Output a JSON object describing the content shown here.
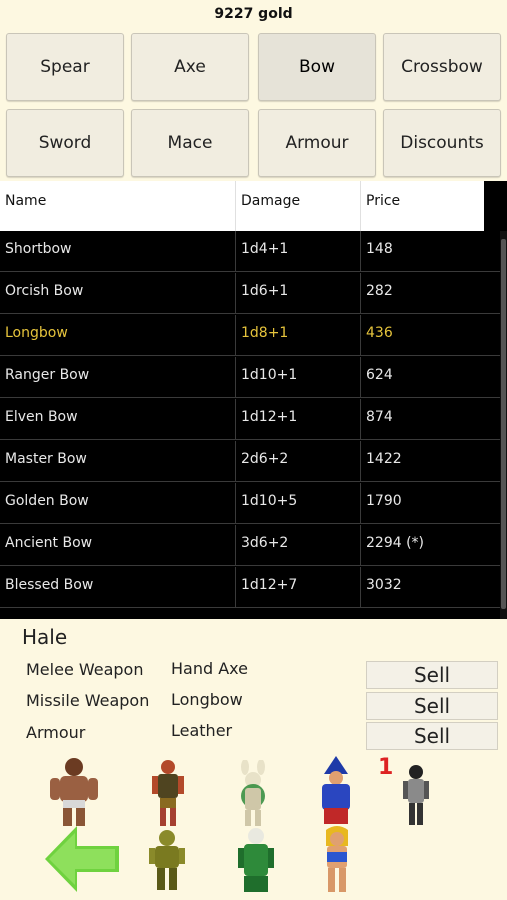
{
  "header": {
    "gold": "9227 gold"
  },
  "tabs": [
    {
      "label": "Spear"
    },
    {
      "label": "Axe"
    },
    {
      "label": "Bow"
    },
    {
      "label": "Crossbow"
    },
    {
      "label": "Sword"
    },
    {
      "label": "Mace"
    },
    {
      "label": "Armour"
    },
    {
      "label": "Discounts"
    }
  ],
  "table": {
    "columns": [
      "Name",
      "Damage",
      "Price"
    ],
    "rows": [
      {
        "name": "Shortbow",
        "damage": "1d4+1",
        "price": "148"
      },
      {
        "name": "Orcish Bow",
        "damage": "1d6+1",
        "price": "282"
      },
      {
        "name": "Longbow",
        "damage": "1d8+1",
        "price": "436"
      },
      {
        "name": "Ranger Bow",
        "damage": "1d10+1",
        "price": "624"
      },
      {
        "name": "Elven Bow",
        "damage": "1d12+1",
        "price": "874"
      },
      {
        "name": "Master Bow",
        "damage": "2d6+2",
        "price": "1422"
      },
      {
        "name": "Golden Bow",
        "damage": "1d10+5",
        "price": "1790"
      },
      {
        "name": "Ancient Bow",
        "damage": "3d6+2",
        "price": "2294 (*)"
      },
      {
        "name": "Blessed Bow",
        "damage": "1d12+7",
        "price": "3032"
      }
    ]
  },
  "character": {
    "name": "Hale",
    "equipment": [
      {
        "slot": "Melee Weapon",
        "item": "Hand Axe",
        "sell_label": "Sell"
      },
      {
        "slot": "Missile Weapon",
        "item": "Longbow",
        "sell_label": "Sell"
      },
      {
        "slot": "Armour",
        "item": "Leather",
        "sell_label": "Sell"
      }
    ]
  },
  "party": {
    "badge": "1"
  },
  "colors": {
    "background": "#fdf8e1",
    "table_bg": "#000000",
    "selected_row_text": "#e6c43c",
    "badge": "#dd2222",
    "back_arrow": "#6fd23f"
  }
}
